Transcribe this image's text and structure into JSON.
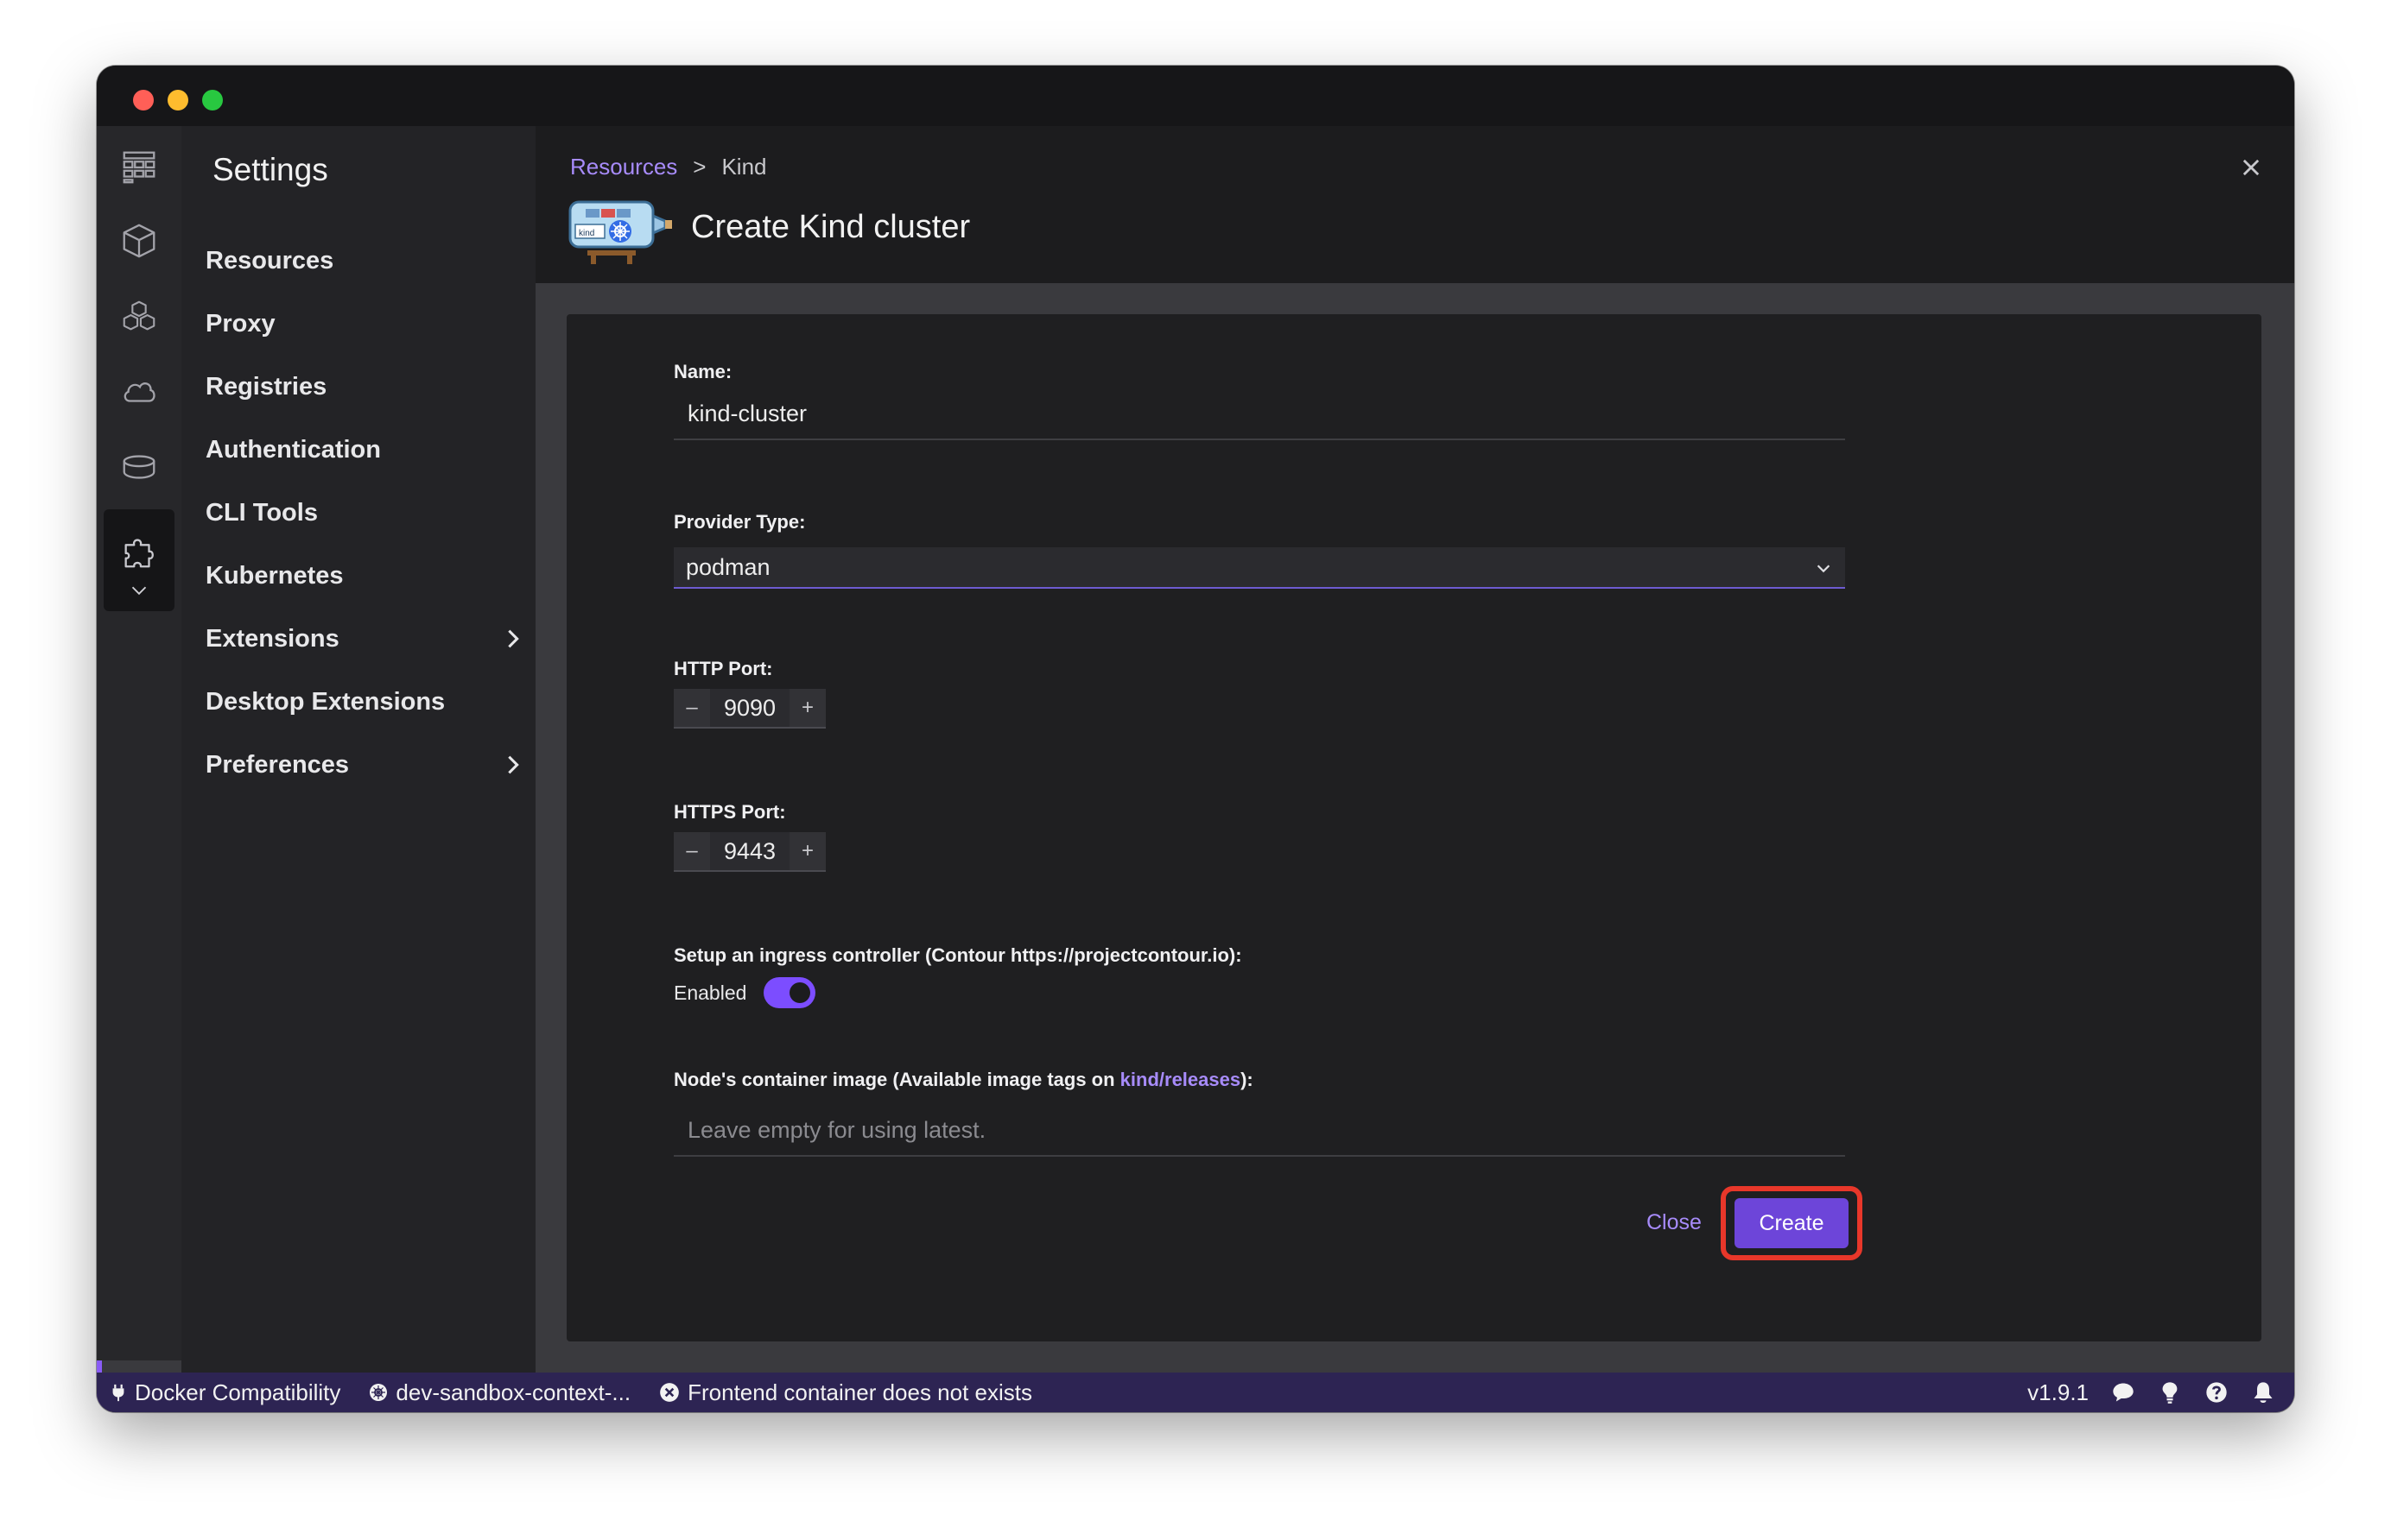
{
  "window": {
    "traffic_lights": [
      "close",
      "minimize",
      "zoom"
    ]
  },
  "iconbar": {
    "items": [
      {
        "name": "dashboard-icon"
      },
      {
        "name": "containers-icon"
      },
      {
        "name": "pods-icon"
      },
      {
        "name": "images-icon"
      },
      {
        "name": "volumes-icon"
      },
      {
        "name": "extensions-icon"
      },
      {
        "name": "chevron-down-icon"
      }
    ],
    "settings_icon": "gear-icon"
  },
  "settings": {
    "title": "Settings",
    "items": [
      {
        "label": "Resources"
      },
      {
        "label": "Proxy"
      },
      {
        "label": "Registries"
      },
      {
        "label": "Authentication"
      },
      {
        "label": "CLI Tools"
      },
      {
        "label": "Kubernetes"
      },
      {
        "label": "Extensions",
        "has_children": true
      },
      {
        "label": "Desktop Extensions"
      },
      {
        "label": "Preferences",
        "has_children": true
      }
    ]
  },
  "header": {
    "breadcrumb_root": "Resources",
    "breadcrumb_sep": ">",
    "breadcrumb_current": "Kind",
    "title": "Create Kind cluster",
    "logo_text": "kind"
  },
  "form": {
    "name_label": "Name:",
    "name_value": "kind-cluster",
    "provider_label": "Provider Type:",
    "provider_value": "podman",
    "http_label": "HTTP Port:",
    "http_value": "9090",
    "https_label": "HTTPS Port:",
    "https_value": "9443",
    "ingress_label": "Setup an ingress controller (Contour https://projectcontour.io):",
    "ingress_toggle_label": "Enabled",
    "ingress_enabled": true,
    "image_label_prefix": "Node's container image (Available image tags on ",
    "image_label_link": "kind/releases",
    "image_label_suffix": "):",
    "image_placeholder": "Leave empty for using latest.",
    "stepper_minus": "–",
    "stepper_plus": "+"
  },
  "actions": {
    "close_label": "Close",
    "create_label": "Create"
  },
  "statusbar": {
    "docker": "Docker Compatibility",
    "context": "dev-sandbox-context-...",
    "error": "Frontend container does not exists",
    "version": "v1.9.1"
  },
  "colors": {
    "accent": "#a78bfa",
    "primary_button": "#6d45d9",
    "highlight_outline": "#e8372a",
    "statusbar": "#2d2453"
  }
}
